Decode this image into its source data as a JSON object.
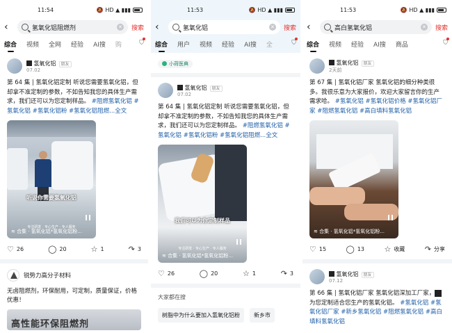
{
  "screens": [
    {
      "time": "11:54",
      "status_icons": "🔕 HD ▲ ▮▮▮",
      "query": "氢氧化铝阻燃剂",
      "search_label": "搜索",
      "tabs": [
        "综合",
        "视频",
        "全网",
        "经验",
        "AI搜",
        "购"
      ],
      "post": {
        "author": "氢氧化铝",
        "badge": "朋友",
        "date": "07.02",
        "text": "第 64 集 | 氢氧化铝定制 听说您需要氢氧化铝，但却拿不准定制的参数，不如告知我您的具体生产需求，我们还可以为您定制样品。",
        "tags": "#阻燃氢氧化铝 #氢氧化铝 #氢氧化铝粉 #氢氧化铝阻燃...",
        "more": "全文",
        "video_caption": "听说你需要氢氧化铝",
        "video_sub": "专注研发 · 专心生产 · 专人服务",
        "collection": "合集 · 氢氧化铝*氢氧化铝粉..."
      },
      "actions": {
        "likes": "26",
        "comments": "20",
        "favorites": "1",
        "shares": "3"
      },
      "ad": {
        "name": "锐势力高分子材料",
        "text": "无卤阻燃剂，环保耐用，可定制，质量保证，价格优惠！",
        "image_text": "高性能环保阻燃剂"
      }
    },
    {
      "time": "11:53",
      "status_icons": "🔕 HD ▲ ▮▮▮",
      "query": "氢氧化铝",
      "search_label": "搜索",
      "tabs": [
        "综合",
        "用户",
        "视频",
        "经验",
        "AI搜",
        "全"
      ],
      "xhs_label": "小荷医典",
      "post": {
        "author": "氢氧化铝",
        "badge": "朋友",
        "date": "07.02",
        "text": "第 64 集 | 氢氧化铝定制 听说您需要氢氧化铝，但却拿不准定制的参数，不如告知我您的具体生产需求，我们还可以为您定制样品。",
        "tags": "#阻燃氢氧化铝 #氢氧化铝 #氢氧化铝粉 #氢氧化铝阻燃...",
        "more": "全文",
        "video_caption": "我们可以为你定制样品",
        "video_sub": "专注研发 · 专心生产 · 专人服务",
        "collection": "合集 · 氢氧化铝*氢氧化铝粉..."
      },
      "actions": {
        "likes": "26",
        "comments": "20",
        "favorites": "1",
        "shares": "3"
      },
      "related_title": "大家都在搜",
      "related": [
        "树脂中为什么要加入氢氧化铝粉",
        "新乡市"
      ]
    },
    {
      "time": "11:53",
      "status_icons": "🔕 HD ▲ ▮▮▮",
      "query": "高白氢氧化铝",
      "search_label": "搜索",
      "tabs": [
        "综合",
        "视频",
        "经验",
        "AI搜",
        "商品"
      ],
      "post": {
        "author": "氢氧化铝",
        "badge": "朋友",
        "date": "2天前",
        "text": "第 67 集 | 氢氧化铝厂家 氢氧化铝的细分种类很多。我很乐意为大家报价，欢迎大家留言你的生产需求哈。",
        "tags": "#氢氧化铝 #氢氧化铝价格 #氢氧化铝厂家 #阻燃氢氧化铝 #高白填料氢氧化铝",
        "more": "",
        "video_caption": "",
        "video_sub": "",
        "collection": "合集 · 氢氧化铝*氢氧化铝粉..."
      },
      "actions": {
        "likes": "15",
        "comments": "13",
        "favorites": "收藏",
        "shares": "分享"
      },
      "post2": {
        "author": "氢氧化铝",
        "badge": "朋友",
        "date": "07.12",
        "text": "第 66 集 | 氢氧化铝厂家 氢氧化铝深加工厂家，",
        "text2": "为您定制适合您生产的氢氧化铝。",
        "tags": "#氢氧化铝 #氢氧化铝厂家 #新乡氢氧化铝 #阻燃氢氧化铝 #高白填料氢氧化铝"
      }
    }
  ],
  "colors": {
    "accent_red": "#e3322d",
    "tag_blue": "#1f5fa8",
    "bg_gray": "#f2f4f6"
  }
}
